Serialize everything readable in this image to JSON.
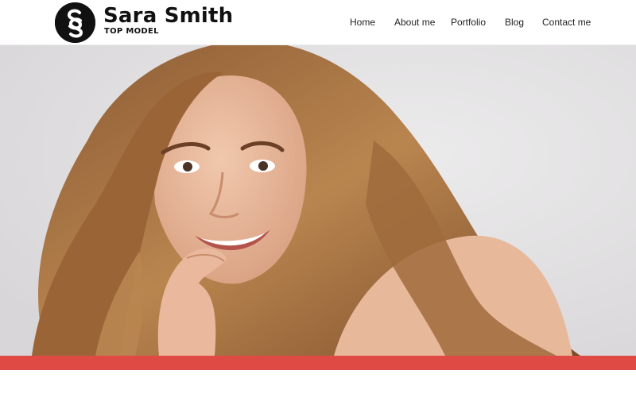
{
  "brand": {
    "name": "Sara Smith",
    "tagline": "TOP MODEL",
    "logo_letters": "SS",
    "logo_color": "#111111"
  },
  "nav": {
    "items": [
      {
        "label": "Home"
      },
      {
        "label": "About me"
      },
      {
        "label": "Portfolio"
      },
      {
        "label": "Blog"
      },
      {
        "label": "Contact me"
      }
    ]
  },
  "hero": {
    "image_subject": "portrait-photo",
    "background_color": "#e4e2e3",
    "accent_color": "#e04a44"
  },
  "main": {
    "heading": ""
  }
}
